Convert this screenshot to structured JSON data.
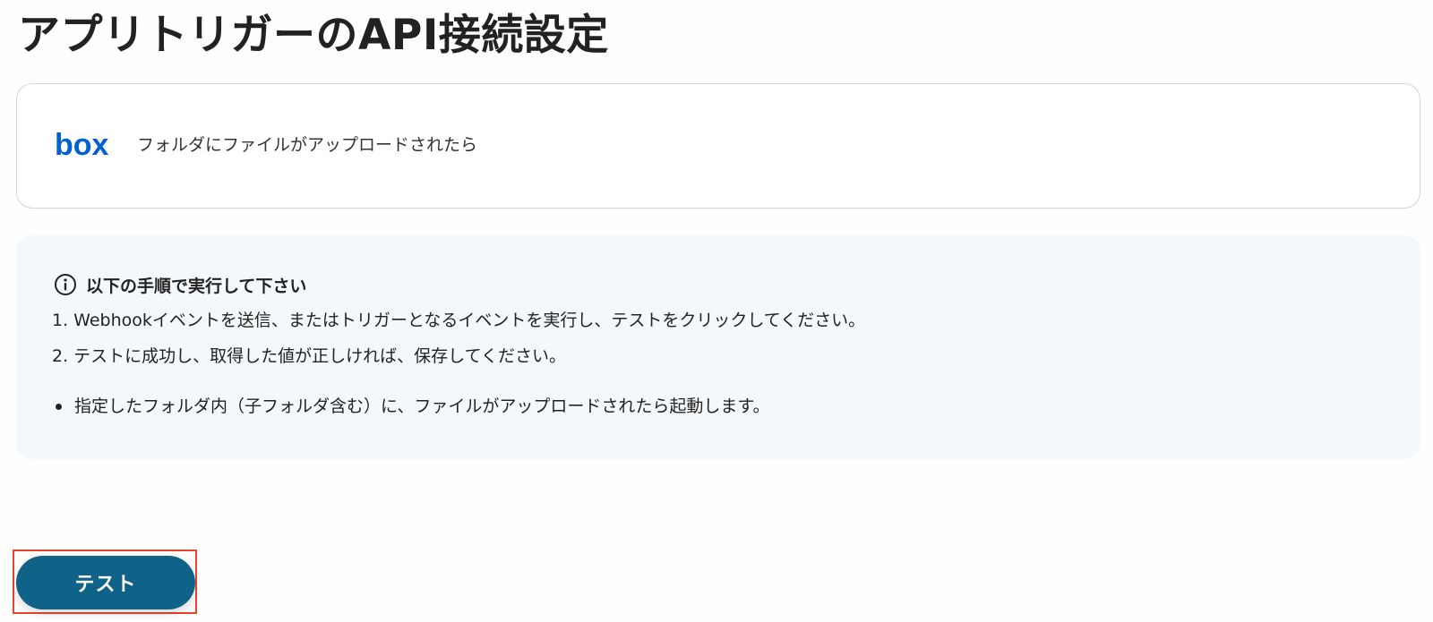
{
  "page": {
    "title": "アプリトリガーのAPI接続設定"
  },
  "app_card": {
    "logo_text": "box",
    "logo_color": "#0061d5",
    "trigger_label": "フォルダにファイルがアップロードされたら"
  },
  "info": {
    "icon": "info-circle-icon",
    "heading": "以下の手順で実行して下さい",
    "steps": [
      "1. Webhookイベントを送信、またはトリガーとなるイベントを実行し、テストをクリックしてください。",
      "2. テストに成功し、取得した値が正しければ、保存してください。"
    ],
    "notes": [
      "指定したフォルダ内（子フォルダ含む）に、ファイルがアップロードされたら起動します。"
    ]
  },
  "actions": {
    "test_label": "テスト",
    "button_color": "#0f6288",
    "highlight_color": "#e8452c"
  }
}
